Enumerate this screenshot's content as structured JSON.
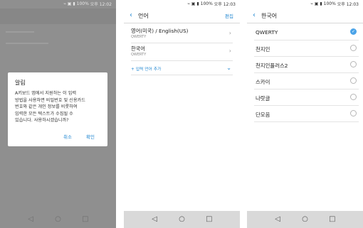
{
  "status": {
    "battery": "100%",
    "p1_time": "오후 12:02",
    "p2_time": "오후 12:03",
    "p3_time": "오후 12:03",
    "icons": "⌁ ▣ ▮"
  },
  "dialog": {
    "title": "알림",
    "body": "A키보드 앱에서 지원하는 이 입력\n방법을 사용하면 비밀번호 및 신용카드\n번호와 같은 개인 정보를 비롯하여\n입력한 모든 텍스트가 수집될 수\n있습니다. 사용하시겠습니까?",
    "cancel": "취소",
    "confirm": "확인"
  },
  "languages": {
    "title": "언어",
    "edit": "편집",
    "items": [
      {
        "label": "영어(미국) / English(US)",
        "layout": "QWERTY"
      },
      {
        "label": "한국어",
        "layout": "QWERTY"
      }
    ],
    "add": "+ 입력 언어 추가"
  },
  "korean": {
    "title": "한국어",
    "options": [
      "QWERTY",
      "천지인",
      "천지인플러스2",
      "스카이",
      "나랏글",
      "단모음"
    ],
    "selected": "QWERTY"
  },
  "icons": {
    "back": "chevron-left-icon",
    "nav_back": "◁",
    "nav_home": "○",
    "nav_recent": "□",
    "check": "✓"
  },
  "colors": {
    "accent": "#1f86d1",
    "radio_on": "#4aa3e8",
    "scrim": "#8f8f8f"
  }
}
